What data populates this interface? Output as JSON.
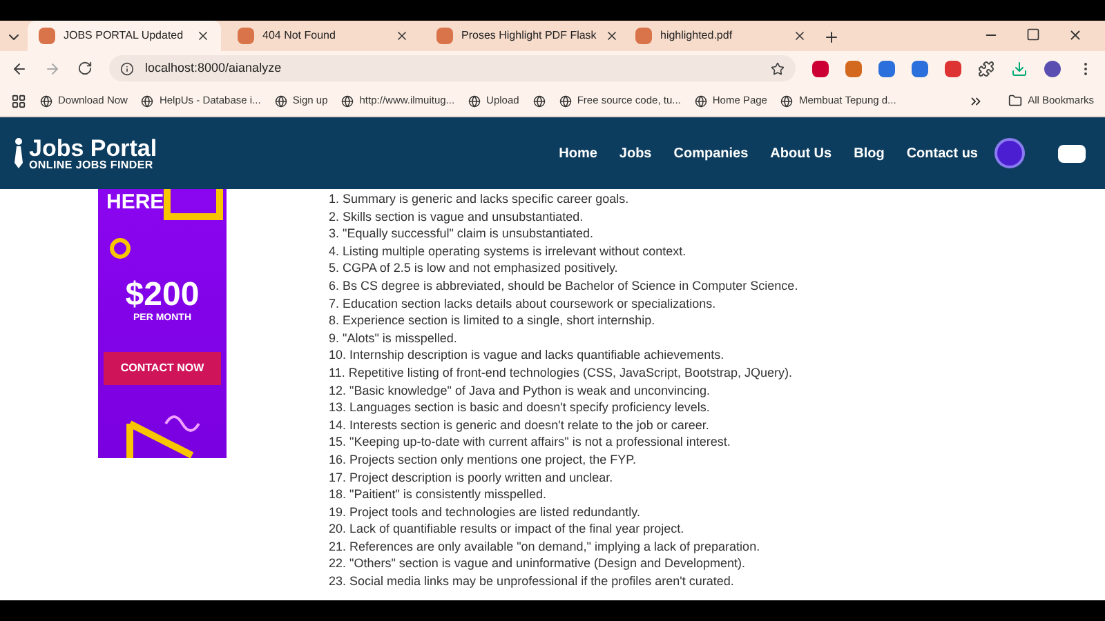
{
  "tabs": [
    {
      "title": "JOBS PORTAL Updated",
      "selected": true
    },
    {
      "title": "404 Not Found",
      "selected": false
    },
    {
      "title": "Proses Highlight PDF Flask",
      "selected": false
    },
    {
      "title": "highlighted.pdf",
      "selected": false
    }
  ],
  "address": "localhost:8000/aianalyze",
  "bookmarks": [
    {
      "kind": "link",
      "label": "Download Now"
    },
    {
      "kind": "link",
      "label": "HelpUs - Database i..."
    },
    {
      "kind": "link",
      "label": "Sign up"
    },
    {
      "kind": "link",
      "label": "http://www.ilmuitug..."
    },
    {
      "kind": "link",
      "label": "Upload"
    },
    {
      "kind": "icon"
    },
    {
      "kind": "link",
      "label": "Free source code, tu..."
    },
    {
      "kind": "link",
      "label": "Home Page"
    },
    {
      "kind": "link",
      "label": "Membuat Tepung d..."
    }
  ],
  "all_bookmarks": "All Bookmarks",
  "site": {
    "logo_title": "Jobs Portal",
    "logo_subtitle": "ONLINE JOBS FINDER",
    "nav": [
      "Home",
      "Jobs",
      "Companies",
      "About Us",
      "Blog",
      "Contact us"
    ]
  },
  "ad": {
    "headline": "HERE",
    "price": "$200",
    "period": "PER MONTH",
    "cta": "CONTACT NOW"
  },
  "feedback": [
    "1. Summary is generic and lacks specific career goals.",
    "2. Skills section is vague and unsubstantiated.",
    "3. \"Equally successful\" claim is unsubstantiated.",
    "4. Listing multiple operating systems is irrelevant without context.",
    "5. CGPA of 2.5 is low and not emphasized positively.",
    "6. Bs CS degree is abbreviated, should be Bachelor of Science in Computer Science.",
    "7. Education section lacks details about coursework or specializations.",
    "8. Experience section is limited to a single, short internship.",
    "9. \"Alots\" is misspelled.",
    "10. Internship description is vague and lacks quantifiable achievements.",
    "11. Repetitive listing of front-end technologies (CSS, JavaScript, Bootstrap, JQuery).",
    "12. \"Basic knowledge\" of Java and Python is weak and unconvincing.",
    "13. Languages section is basic and doesn't specify proficiency levels.",
    "14. Interests section is generic and doesn't relate to the job or career.",
    "15. \"Keeping up-to-date with current affairs\" is not a professional interest.",
    "16. Projects section only mentions one project, the FYP.",
    "17. Project description is poorly written and unclear.",
    "18. \"Paitient\" is consistently misspelled.",
    "19. Project tools and technologies are listed redundantly.",
    "20. Lack of quantifiable results or impact of the final year project.",
    "21. References are only available \"on demand,\" implying a lack of preparation.",
    "22. \"Others\" section is vague and uninformative (Design and Development).",
    "23. Social media links may be unprofessional if the profiles aren't curated."
  ]
}
